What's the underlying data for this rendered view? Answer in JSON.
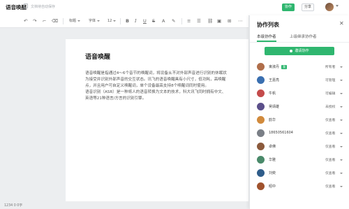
{
  "header": {
    "doc_title": "语音唤醒",
    "hint": "文档待自动保存",
    "collab_label": "协作",
    "share_label": "分享"
  },
  "toolbar": {
    "font_style": "标题",
    "font_family": "字体",
    "font_size": "12"
  },
  "document": {
    "heading": "语音唤醒",
    "lines": [
      "语音唤醒是指通过4～6个音节的唤醒词，将设备从不对外部声音进行识别的休眠状",
      "为接受并识别外部声音的交互状态。讯飞的语音唤醒具有小尺寸，低功耗，高唤醒",
      "点，并且用户可自定义唤醒词，单个设备最高支持8个唤醒词同时使用。",
      "语音识别（ASR）是一种将人的语音转换为文本的技术，科大讯飞同时拥有中文、",
      "英语等21种语言/方言的识别引擎。"
    ],
    "word_count": "1234 0 0字"
  },
  "panel": {
    "title": "协作列表",
    "tabs": [
      "本级协作者",
      "上级继承协作者"
    ],
    "invite_label": "邀请协作",
    "users": [
      {
        "name": "東淑丹",
        "badge": "我",
        "perm": "所有者",
        "color": "#b06e4a"
      },
      {
        "name": "王嘉亮",
        "badge": "",
        "perm": "可管理",
        "color": "#3a6fb0"
      },
      {
        "name": "牛帆",
        "badge": "",
        "perm": "可编辑",
        "color": "#c44b4b"
      },
      {
        "name": "吴靖雄",
        "badge": "",
        "perm": "未授权",
        "color": "#5b4f8a"
      },
      {
        "name": "韵华",
        "badge": "",
        "perm": "仅查看",
        "color": "#d18a3c"
      },
      {
        "name": "18650561604",
        "badge": "",
        "perm": "仅查看",
        "color": "#7a7f86"
      },
      {
        "name": "卓佛",
        "badge": "",
        "perm": "仅查看",
        "color": "#8b5a3c"
      },
      {
        "name": "华雅",
        "badge": "",
        "perm": "仅查看",
        "color": "#4a8a6a"
      },
      {
        "name": "刘奕",
        "badge": "",
        "perm": "仅查看",
        "color": "#2f5d8a"
      },
      {
        "name": "昭中",
        "badge": "",
        "perm": "仅查看",
        "color": "#a0522d"
      }
    ]
  },
  "colors": {
    "accent": "#2fb66f"
  }
}
